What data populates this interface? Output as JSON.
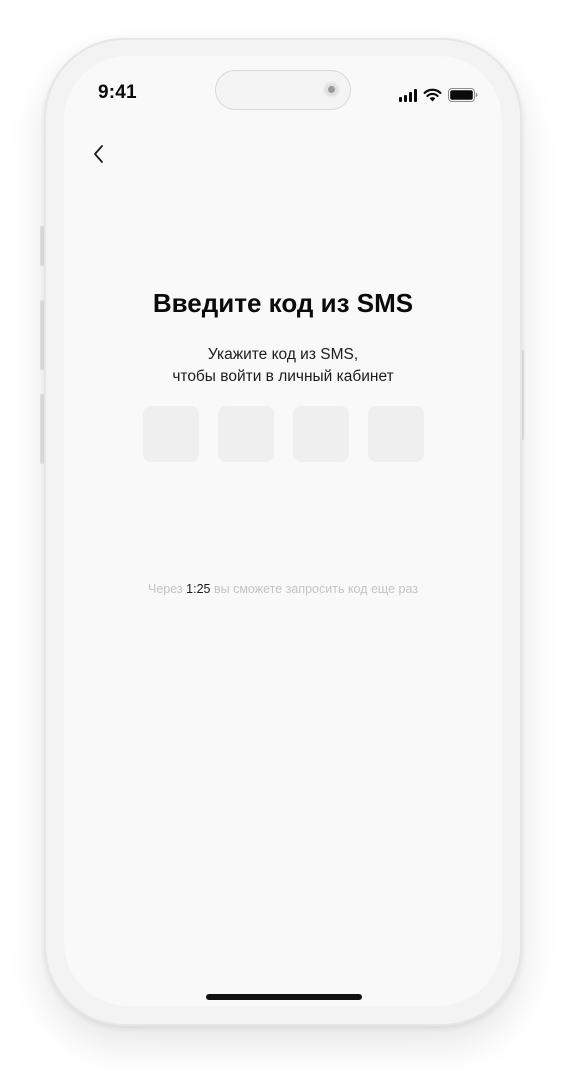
{
  "status_bar": {
    "time": "9:41"
  },
  "navigation": {
    "back_icon": "chevron-left-icon"
  },
  "sms_verification": {
    "title": "Введите код из SMS",
    "subtitle_line1": "Укажите код из SMS,",
    "subtitle_line2": "чтобы войти в личный кабинет",
    "code_digits": [
      "",
      "",
      "",
      ""
    ],
    "resend_prefix": "Через",
    "resend_timer": "1:25",
    "resend_suffix": "вы сможете запросить код еще раз"
  },
  "colors": {
    "background": "#f9f9f9",
    "code_box": "#efefef",
    "muted_text": "#c4c4c4",
    "text": "#0b0b0b"
  }
}
